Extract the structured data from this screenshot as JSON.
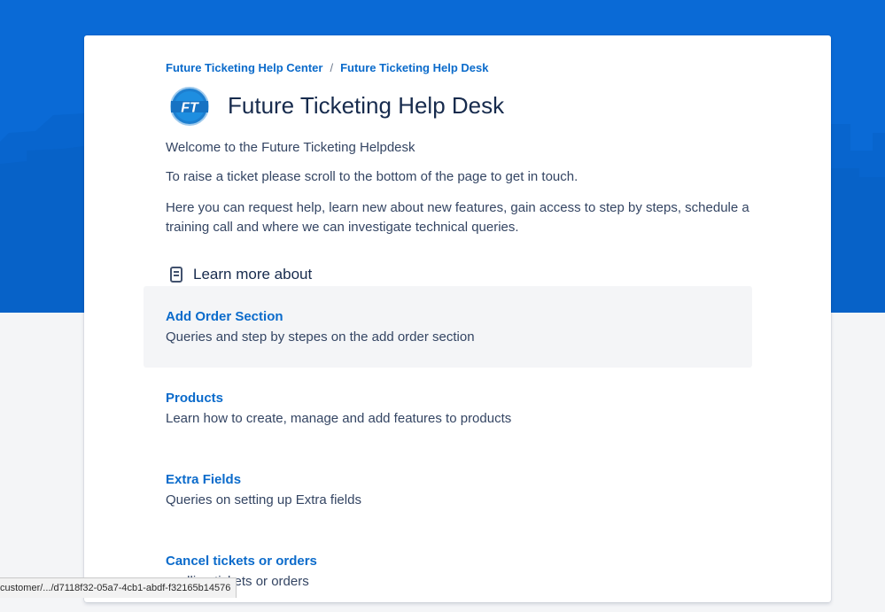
{
  "breadcrumbs": [
    {
      "label": "Future Ticketing Help Center"
    },
    {
      "label": "Future Ticketing Help Desk"
    }
  ],
  "breadcrumb_separator": "/",
  "logo": {
    "text": "FT"
  },
  "header": {
    "title": "Future Ticketing Help Desk"
  },
  "description": [
    "Welcome to the Future Ticketing Helpdesk",
    "To raise a ticket please scroll to the bottom of the page to get in touch.",
    "Here you can request help, learn new about new features, gain access to step by steps, schedule a training call and where we can investigate technical queries."
  ],
  "section": {
    "title": "Learn more about",
    "icon": "article-icon"
  },
  "topics": [
    {
      "name": "Add Order Section",
      "description": "Queries and step by stepes on the add order section",
      "hovered": true
    },
    {
      "name": "Products",
      "description": "Learn how to create, manage and add features to products",
      "hovered": false
    },
    {
      "name": "Extra Fields",
      "description": "Queries on setting up Extra fields",
      "hovered": false
    },
    {
      "name": "Cancel tickets or orders",
      "description": "ncelling tickets or orders",
      "hovered": false
    }
  ],
  "status_bar": {
    "url": "customer/.../d7118f32-05a7-4cb1-abdf-f32165b14576"
  },
  "colors": {
    "banner": "#0a6ad6",
    "link": "#0b6bcb",
    "text": "#172b4d",
    "hover_bg": "#f4f5f7"
  }
}
